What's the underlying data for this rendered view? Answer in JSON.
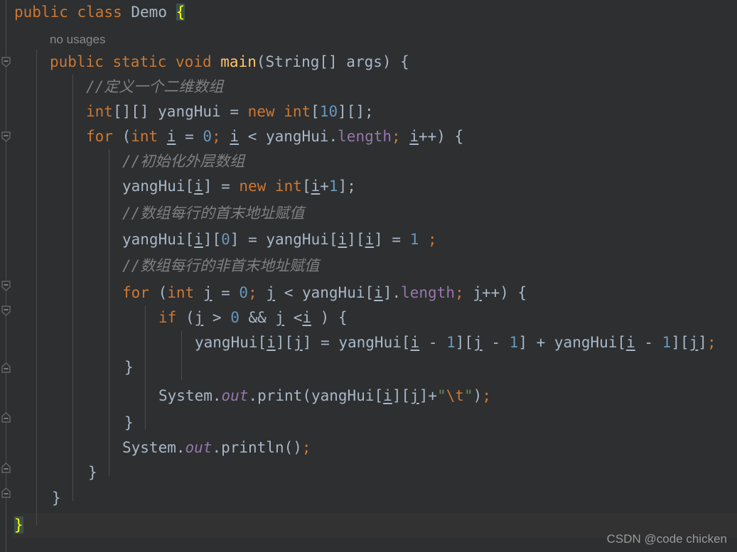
{
  "editor": {
    "theme": "darcula",
    "background": "#2d2f31",
    "default_text_color": "#a9b7c6",
    "current_line_background": "#323232",
    "matched_brace_background": "#3b514d",
    "matched_brace_color": "#ffff00",
    "colors": {
      "keyword": "#cc7832",
      "number": "#6897bb",
      "identifier": "#a9b7c6",
      "method_declaration": "#ffc66d",
      "field": "#9876aa",
      "static_field": "#9876aa",
      "comment": "#808080",
      "string": "#6a8759",
      "escape": "#cc7832",
      "semicolon": "#cc7832",
      "gutter_line": "#4a4c4e",
      "indent_guide": "#4a4c4e"
    }
  },
  "inlay_hints": [
    {
      "text": "no usages",
      "line": 2
    }
  ],
  "code_lines": [
    {
      "n": 1,
      "indent": 0,
      "text": "public class Demo {"
    },
    {
      "n": 2,
      "indent": 1,
      "text": "no usages"
    },
    {
      "n": 3,
      "indent": 1,
      "text": "public static void main(String[] args) {"
    },
    {
      "n": 4,
      "indent": 2,
      "text": "//定义一个二维数组"
    },
    {
      "n": 5,
      "indent": 2,
      "text": "int[][] yangHui = new int[10][];"
    },
    {
      "n": 6,
      "indent": 2,
      "text": "for (int i = 0; i < yangHui.length; i++) {"
    },
    {
      "n": 7,
      "indent": 3,
      "text": "//初始化外层数组"
    },
    {
      "n": 8,
      "indent": 3,
      "text": "yangHui[i] = new int[i+1];"
    },
    {
      "n": 9,
      "indent": 3,
      "text": "//数组每行的首末地址赋值"
    },
    {
      "n": 10,
      "indent": 3,
      "text": "yangHui[i][0] = yangHui[i][i] = 1 ;"
    },
    {
      "n": 11,
      "indent": 3,
      "text": "//数组每行的非首末地址赋值"
    },
    {
      "n": 12,
      "indent": 3,
      "text": "for (int j = 0; j < yangHui[i].length; j++) {"
    },
    {
      "n": 13,
      "indent": 4,
      "text": "if (j > 0 && j <i ) {"
    },
    {
      "n": 14,
      "indent": 5,
      "text": "yangHui[i][j] = yangHui[i - 1][j - 1] + yangHui[i - 1][j];"
    },
    {
      "n": 15,
      "indent": 4,
      "text": "}"
    },
    {
      "n": 16,
      "indent": 4,
      "text": "System.out.print(yangHui[i][j]+\"\\t\");"
    },
    {
      "n": 17,
      "indent": 3,
      "text": "}"
    },
    {
      "n": 18,
      "indent": 3,
      "text": "System.out.println();"
    },
    {
      "n": 19,
      "indent": 2,
      "text": "}"
    },
    {
      "n": 20,
      "indent": 1,
      "text": "}"
    },
    {
      "n": 21,
      "indent": 0,
      "text": "}"
    }
  ],
  "fold_markers": [
    {
      "type": "fold-collapse-icon",
      "line": 3,
      "direction": "down"
    },
    {
      "type": "fold-collapse-icon",
      "line": 6,
      "direction": "down"
    },
    {
      "type": "fold-collapse-icon",
      "line": 12,
      "direction": "down"
    },
    {
      "type": "fold-collapse-icon",
      "line": 13,
      "direction": "down"
    },
    {
      "type": "fold-end-icon",
      "line": 15,
      "direction": "up"
    },
    {
      "type": "fold-end-icon",
      "line": 17,
      "direction": "up"
    },
    {
      "type": "fold-end-icon",
      "line": 19,
      "direction": "up"
    },
    {
      "type": "fold-end-icon",
      "line": 20,
      "direction": "up"
    }
  ],
  "watermark": {
    "text": "CSDN @code chicken"
  }
}
